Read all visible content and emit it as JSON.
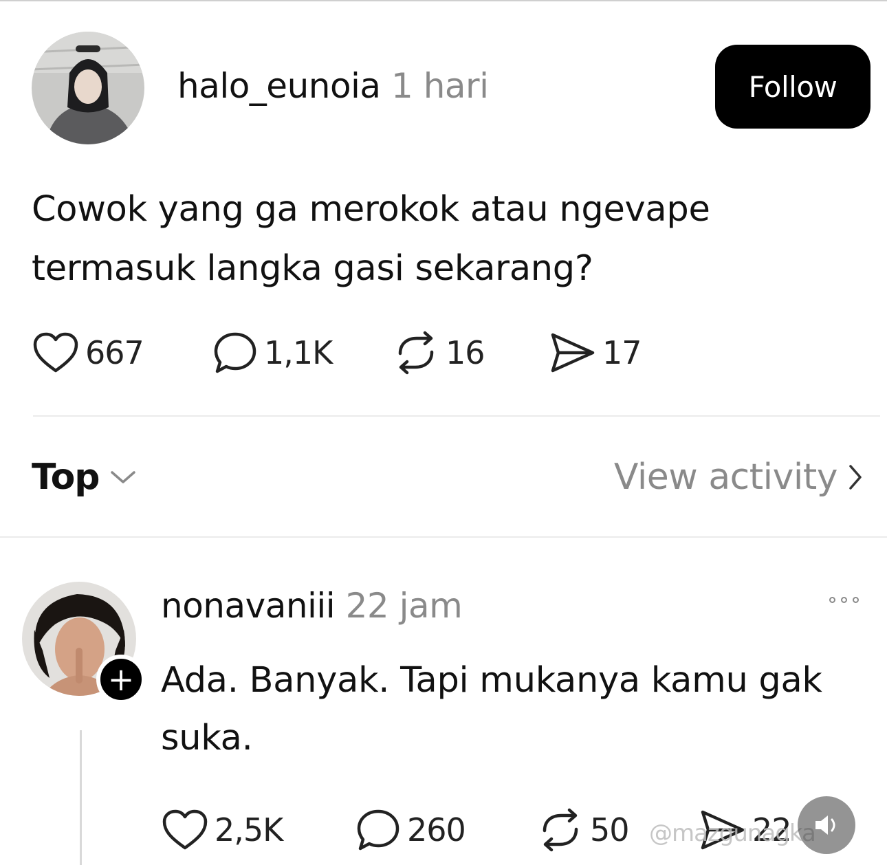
{
  "post": {
    "username": "halo_eunoia",
    "time": "1 hari",
    "follow_label": "Follow",
    "text_line1": "Cowok yang ga merokok atau ngevape",
    "text_line2": "termasuk langka gasi sekarang?",
    "likes": "667",
    "replies": "1,1K",
    "reposts": "16",
    "shares": "17"
  },
  "sort": {
    "label": "Top",
    "view_activity": "View activity"
  },
  "reply": {
    "username": "nonavaniii",
    "time": "22 jam",
    "text_line1": "Ada. Banyak. Tapi mukanya kamu gak",
    "text_line2": "suka.",
    "likes": "2,5K",
    "replies": "260",
    "reposts": "50",
    "shares": "22"
  },
  "watermark": "@mazgunagka",
  "icons": {
    "like": "heart-icon",
    "reply": "comment-bubble-icon",
    "repost": "repost-icon",
    "share": "send-icon",
    "sort": "chevron-down-icon",
    "activity": "chevron-right-icon",
    "more": "more-dots-icon",
    "sound": "speaker-icon"
  }
}
